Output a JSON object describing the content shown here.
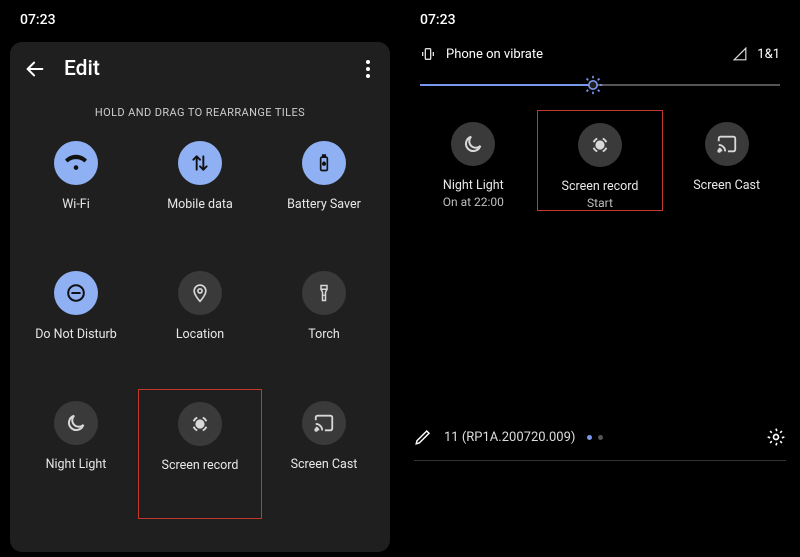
{
  "left": {
    "time": "07:23",
    "title": "Edit",
    "instruction": "HOLD AND DRAG TO REARRANGE TILES",
    "tiles": [
      {
        "label": "Wi-Fi",
        "icon": "wifi",
        "active": true
      },
      {
        "label": "Mobile data",
        "icon": "mobiledata",
        "active": true
      },
      {
        "label": "Battery Saver",
        "icon": "battery",
        "active": true
      },
      {
        "label": "Do Not Disturb",
        "icon": "dnd",
        "active": true
      },
      {
        "label": "Location",
        "icon": "location",
        "active": false
      },
      {
        "label": "Torch",
        "icon": "torch",
        "active": false
      },
      {
        "label": "Night Light",
        "icon": "nightlight",
        "active": false
      },
      {
        "label": "Screen record",
        "icon": "screenrecord",
        "active": false,
        "highlight": true
      },
      {
        "label": "Screen Cast",
        "icon": "cast",
        "active": false
      }
    ]
  },
  "right": {
    "time": "07:23",
    "ringer_label": "Phone on vibrate",
    "signal_label": "1&1",
    "brightness_percent": 48,
    "tiles": [
      {
        "label": "Night Light",
        "sublabel": "On at 22:00",
        "icon": "nightlight",
        "active": false
      },
      {
        "label": "Screen record",
        "sublabel": "Start",
        "icon": "screenrecord",
        "active": false,
        "highlight": true
      },
      {
        "label": "Screen Cast",
        "sublabel": "",
        "icon": "cast",
        "active": false
      }
    ],
    "build_label": "11 (RP1A.200720.009)"
  }
}
